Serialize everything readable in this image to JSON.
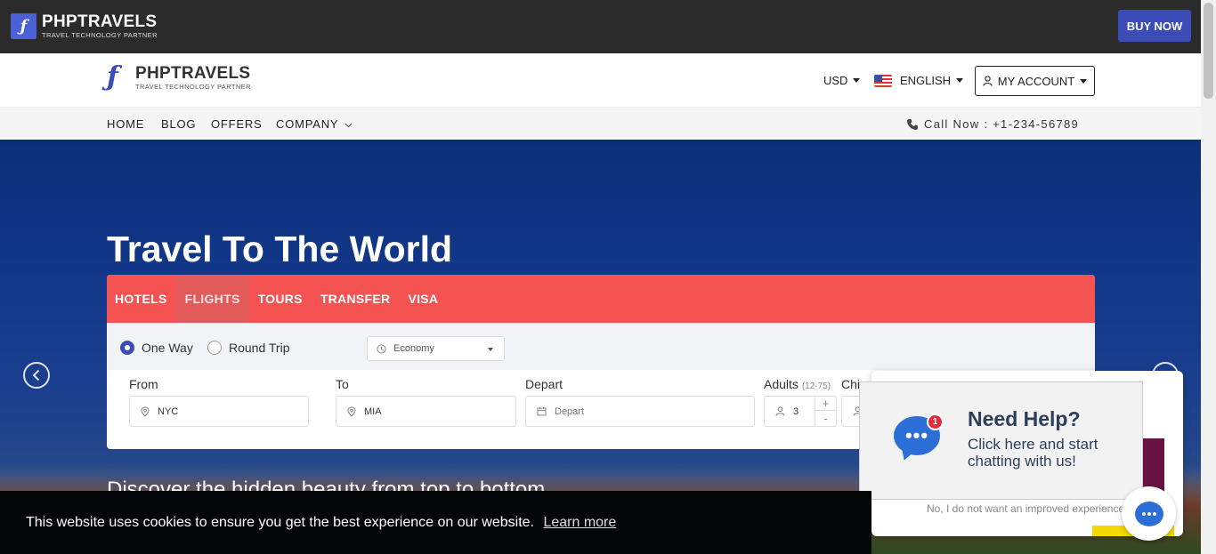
{
  "topbar": {
    "logo_name": "PHPTRAVELS",
    "logo_tagline": "TRAVEL TECHNOLOGY PARTNER",
    "buy_label": "BUY NOW"
  },
  "header": {
    "logo_name": "PHPTRAVELS",
    "logo_tagline": "TRAVEL TECHNOLOGY PARTNER",
    "currency": "USD",
    "language": "ENGLISH",
    "account_label": "MY ACCOUNT"
  },
  "nav": {
    "items": [
      "HOME",
      "BLOG",
      "OFFERS",
      "COMPANY"
    ],
    "call_text": "Call Now : +1-234-56789"
  },
  "hero": {
    "title": "Travel To The World",
    "subtitle": "Discover the hidden beauty from top to bottom"
  },
  "search": {
    "tabs": [
      "HOTELS",
      "FLIGHTS",
      "TOURS",
      "TRANSFER",
      "VISA"
    ],
    "active_tab": "FLIGHTS",
    "trip_types": [
      "One Way",
      "Round Trip"
    ],
    "selected_trip": "One Way",
    "cabin_class": "Economy",
    "labels": {
      "from": "From",
      "to": "To",
      "depart": "Depart",
      "adults": "Adults",
      "adults_range": "(12-75)",
      "children": "Chi"
    },
    "from_value": "NYC",
    "to_value": "MIA",
    "depart_placeholder": "Depart",
    "adults_value": "3",
    "plus": "+",
    "minus": "-"
  },
  "chat": {
    "badge": "1",
    "bubble_dots": "•••",
    "title": "Need Help?",
    "message": "Click here and start chatting with us!",
    "decline": "No, I do not want an improved experience"
  },
  "cookie": {
    "text": "This website uses cookies to ensure you get the best experience on our website.",
    "link": "Learn more"
  },
  "colors": {
    "brand_blue": "#3b4bb8",
    "tab_red": "#f55252",
    "chat_blue": "#2b6fd6"
  }
}
